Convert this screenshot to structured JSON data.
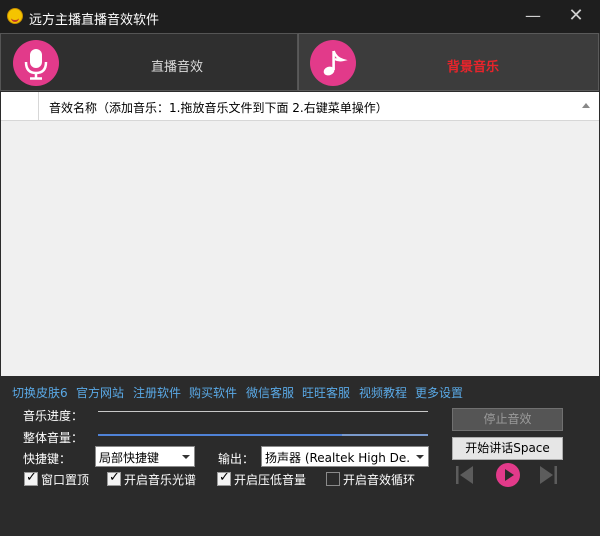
{
  "window": {
    "title": "远方主播直播音效软件",
    "minimize": "—",
    "close": "✕"
  },
  "tabs": [
    {
      "label": "直播音效",
      "icon": "microphone-icon",
      "active": false
    },
    {
      "label": "背景音乐",
      "icon": "music-note-icon",
      "active": true
    }
  ],
  "colors": {
    "accent": "#e23a8a",
    "active_tab_text": "#e8242b",
    "link": "#5aa9e6"
  },
  "list": {
    "column_header": "音效名称（添加音乐：1.拖放音乐文件到下面   2.右键菜单操作）",
    "rows": []
  },
  "links": [
    "切换皮肤6",
    "官方网站",
    "注册软件",
    "购买软件",
    "微信客服",
    "旺旺客服",
    "视频教程",
    "更多设置"
  ],
  "controls": {
    "progress_label": "音乐进度：",
    "progress": 0,
    "volume_label": "整体音量：",
    "volume": 0.74,
    "hotkey_label": "快捷键：",
    "hotkey_value": "局部快捷键",
    "output_label": "输出：",
    "output_value": "扬声器 (Realtek High De..."
  },
  "checkboxes": [
    {
      "label": "窗口置顶",
      "checked": true
    },
    {
      "label": "开启音乐光谱",
      "checked": true
    },
    {
      "label": "开启压低音量",
      "checked": true
    },
    {
      "label": "开启音效循环",
      "checked": false
    }
  ],
  "buttons": {
    "stop": "停止音效",
    "talk": "开始讲话Space"
  },
  "player": {
    "prev_icon": "skip-previous-icon",
    "play_icon": "play-icon",
    "next_icon": "skip-next-icon"
  }
}
